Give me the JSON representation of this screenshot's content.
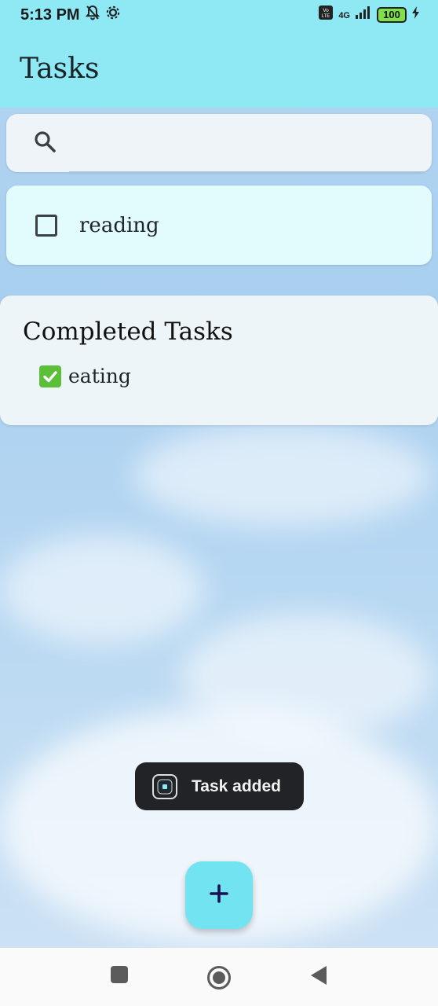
{
  "status_bar": {
    "time": "5:13 PM",
    "network": "4G",
    "battery": "100",
    "icons": [
      "notifications-off-icon",
      "settings-icon",
      "volte-icon",
      "signal-icon",
      "battery-icon",
      "charging-icon"
    ]
  },
  "app_bar": {
    "title": "Tasks"
  },
  "search": {
    "placeholder": "",
    "icon": "search-icon"
  },
  "tasks": [
    {
      "label": "reading",
      "checked": false
    }
  ],
  "completed": {
    "title": "Completed Tasks",
    "items": [
      {
        "emoji": "✅",
        "label": "eating"
      }
    ]
  },
  "toast": {
    "text": "Task added"
  },
  "fab": {
    "label": "+",
    "icon": "add-icon"
  },
  "nav": {
    "buttons": [
      "recents-button",
      "home-button",
      "back-button"
    ]
  },
  "colors": {
    "app_bar": "#8ee9f5",
    "fab": "#72e3f0",
    "task_card": "#e2fbfd",
    "completed_card": "#edf5f9",
    "toast_bg": "#222326"
  }
}
